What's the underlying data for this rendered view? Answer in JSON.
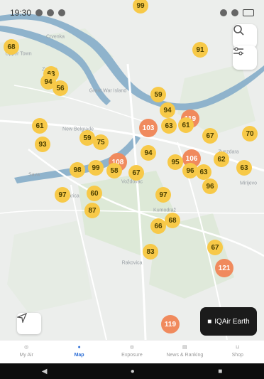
{
  "status_bar": {
    "time": "19:30"
  },
  "map": {
    "places": [
      "Crvenka",
      "Upper Town",
      "Zemun",
      "New Belgrade",
      "Great War Island",
      "Sava",
      "Voždovac",
      "Čukarica",
      "Rakovica",
      "Mirijevo",
      "Zvezdara",
      "Kumodraž"
    ],
    "aqi_markers": [
      {
        "value": "99",
        "level": "moderate"
      },
      {
        "value": "68",
        "level": "moderate"
      },
      {
        "value": "91",
        "level": "moderate"
      },
      {
        "value": "63",
        "level": "moderate"
      },
      {
        "value": "94",
        "level": "moderate"
      },
      {
        "value": "56",
        "level": "moderate"
      },
      {
        "value": "59",
        "level": "moderate"
      },
      {
        "value": "94",
        "level": "moderate"
      },
      {
        "value": "119",
        "level": "unhealthy-sensitive"
      },
      {
        "value": "61",
        "level": "moderate"
      },
      {
        "value": "103",
        "level": "unhealthy-sensitive"
      },
      {
        "value": "63",
        "level": "moderate"
      },
      {
        "value": "61",
        "level": "moderate"
      },
      {
        "value": "67",
        "level": "moderate"
      },
      {
        "value": "70",
        "level": "moderate"
      },
      {
        "value": "93",
        "level": "moderate"
      },
      {
        "value": "59",
        "level": "moderate"
      },
      {
        "value": "75",
        "level": "moderate"
      },
      {
        "value": "94",
        "level": "moderate"
      },
      {
        "value": "106",
        "level": "unhealthy-sensitive"
      },
      {
        "value": "62",
        "level": "moderate"
      },
      {
        "value": "108",
        "level": "unhealthy-sensitive"
      },
      {
        "value": "95",
        "level": "moderate"
      },
      {
        "value": "98",
        "level": "moderate"
      },
      {
        "value": "99",
        "level": "moderate"
      },
      {
        "value": "58",
        "level": "moderate"
      },
      {
        "value": "67",
        "level": "moderate"
      },
      {
        "value": "96",
        "level": "moderate"
      },
      {
        "value": "63",
        "level": "moderate"
      },
      {
        "value": "63",
        "level": "moderate"
      },
      {
        "value": "96",
        "level": "moderate"
      },
      {
        "value": "97",
        "level": "moderate"
      },
      {
        "value": "60",
        "level": "moderate"
      },
      {
        "value": "97",
        "level": "moderate"
      },
      {
        "value": "87",
        "level": "moderate"
      },
      {
        "value": "68",
        "level": "moderate"
      },
      {
        "value": "66",
        "level": "moderate"
      },
      {
        "value": "83",
        "level": "moderate"
      },
      {
        "value": "67",
        "level": "moderate"
      },
      {
        "value": "121",
        "level": "unhealthy-sensitive"
      },
      {
        "value": "119",
        "level": "unhealthy-sensitive"
      }
    ],
    "search_icon": "search-icon",
    "filter_icon": "filter-icon",
    "locate_icon": "navigation-arrow-icon",
    "earth_label": "IQAir Earth"
  },
  "bottom_nav": [
    {
      "label": "My Air",
      "icon": "location-pin-icon",
      "active": false
    },
    {
      "label": "Map",
      "icon": "globe-icon",
      "active": true
    },
    {
      "label": "Exposure",
      "icon": "exposure-icon",
      "active": false
    },
    {
      "label": "News & Ranking",
      "icon": "news-icon",
      "active": false
    },
    {
      "label": "Shop",
      "icon": "cart-icon",
      "active": false
    }
  ],
  "colors": {
    "moderate": "#f7c948",
    "unhealthy_sensitive": "#f08a5d",
    "active_tab": "#2e6fd6",
    "river": "#8fb3cc"
  }
}
